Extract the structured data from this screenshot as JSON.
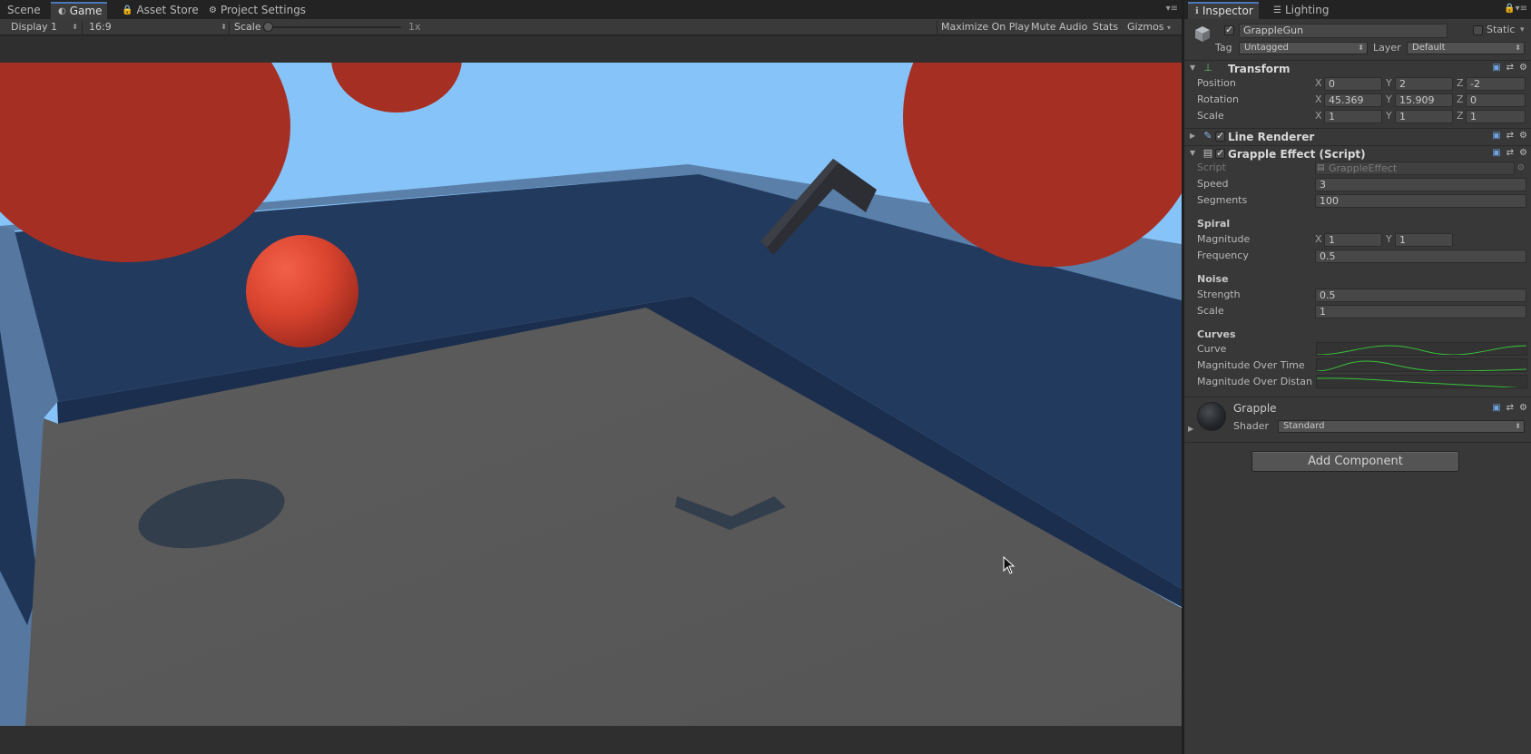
{
  "left_tabs": [
    {
      "label": "Scene",
      "icon": "scene-icon"
    },
    {
      "label": "Game",
      "icon": "game-icon"
    },
    {
      "label": "Asset Store",
      "icon": "lock-icon"
    },
    {
      "label": "Project Settings",
      "icon": "gear-icon"
    }
  ],
  "game_toolbar": {
    "display": "Display 1",
    "aspect": "16:9",
    "scale_label": "Scale",
    "scale_value": "1x",
    "scale_fraction": 0.0,
    "maximize": "Maximize On Play",
    "mute": "Mute Audio",
    "stats": "Stats",
    "gizmos": "Gizmos"
  },
  "inspector_tabs": [
    {
      "label": "Inspector",
      "icon": "info-icon"
    },
    {
      "label": "Lighting",
      "icon": "lighting-icon"
    }
  ],
  "object": {
    "name": "GrappleGun",
    "active": true,
    "static_label": "Static",
    "static": false,
    "tag_label": "Tag",
    "tag_value": "Untagged",
    "layer_label": "Layer",
    "layer_value": "Default"
  },
  "transform": {
    "title": "Transform",
    "position_label": "Position",
    "rotation_label": "Rotation",
    "scale_label": "Scale",
    "position": {
      "x": "0",
      "y": "2",
      "z": "-2"
    },
    "rotation": {
      "x": "45.369",
      "y": "15.909",
      "z": "0"
    },
    "scale": {
      "x": "1",
      "y": "1",
      "z": "1"
    }
  },
  "axis": {
    "x": "X",
    "y": "Y",
    "z": "Z"
  },
  "line_renderer": {
    "title": "Line Renderer",
    "enabled": true
  },
  "grapple_effect": {
    "title": "Grapple Effect (Script)",
    "enabled": true,
    "script_label": "Script",
    "script_value": "GrappleEffect",
    "speed_label": "Speed",
    "speed": "3",
    "segments_label": "Segments",
    "segments": "100",
    "spiral_header": "Spiral",
    "magnitude_label": "Magnitude",
    "magnitude": {
      "x": "1",
      "y": "1"
    },
    "frequency_label": "Frequency",
    "frequency": "0.5",
    "noise_header": "Noise",
    "strength_label": "Strength",
    "strength": "0.5",
    "noise_scale_label": "Scale",
    "noise_scale": "1",
    "curves_header": "Curves",
    "curve_label": "Curve",
    "mag_time_label": "Magnitude Over Time",
    "mag_dist_label": "Magnitude Over Distan"
  },
  "material": {
    "name": "Grapple",
    "shader_label": "Shader",
    "shader": "Standard"
  },
  "add_component": "Add Component",
  "colors": {
    "sky": "#86c3f8",
    "wall_top": "#5a7fa8",
    "wall_face": "#223a5e",
    "floor": "#585858",
    "sphere": "#a62f24",
    "curve": "#37c23a"
  }
}
